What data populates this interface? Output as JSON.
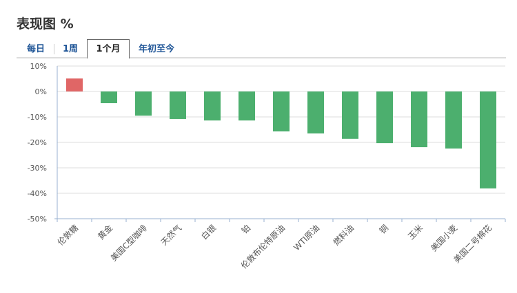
{
  "header": {
    "title": "表现图 %"
  },
  "tabs": [
    {
      "label": "每日"
    },
    {
      "label": "1周"
    },
    {
      "label": "1个月",
      "active": true
    },
    {
      "label": "年初至今"
    }
  ],
  "colors": {
    "positive": "#e06666",
    "negative": "#4caf6e",
    "grid": "#dddddd",
    "axis": "#98b0d0"
  },
  "chart_data": {
    "type": "bar",
    "title": "表现图 %",
    "categories": [
      "伦敦糖",
      "黄金",
      "美国C型咖啡",
      "天然气",
      "白银",
      "铂",
      "伦敦布伦特原油",
      "WTI原油",
      "燃料油",
      "铜",
      "玉米",
      "美国小麦",
      "美国二号棉花"
    ],
    "values": [
      5.1,
      -4.6,
      -9.5,
      -10.8,
      -11.4,
      -11.4,
      -15.7,
      -16.5,
      -18.6,
      -20.3,
      -21.9,
      -22.4,
      -38.1
    ],
    "ylim": [
      -50,
      10
    ],
    "yticks": [
      "10%",
      "0%",
      "-10%",
      "-20%",
      "-30%",
      "-40%",
      "-50%"
    ],
    "ytick_values": [
      10,
      0,
      -10,
      -20,
      -30,
      -40,
      -50
    ],
    "grid": true,
    "xlabel": "",
    "ylabel": ""
  }
}
